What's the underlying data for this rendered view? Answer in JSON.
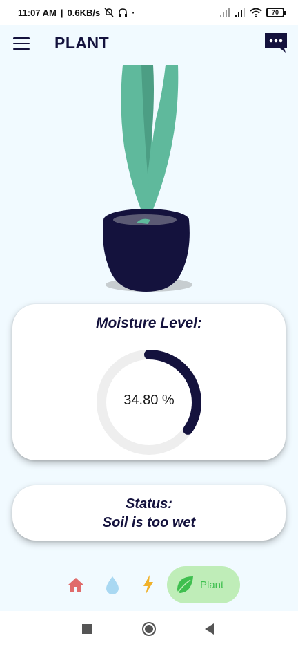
{
  "status_bar": {
    "time": "11:07 AM",
    "network_speed": "0.6KB/s",
    "battery": "70",
    "icons": [
      "mute-icon",
      "headphones-icon",
      "signal-icon",
      "signal-icon",
      "wifi-icon",
      "battery-icon"
    ]
  },
  "app_bar": {
    "title": "PLANT",
    "menu_icon": "hamburger-menu-icon",
    "chat_icon": "chat-bubble-icon"
  },
  "moisture": {
    "title": "Moisture Level:",
    "value_text": "34.80 %",
    "value_percent": 34.8
  },
  "status": {
    "title": "Status:",
    "text": "Soil is too wet"
  },
  "bottom_nav": {
    "items": [
      {
        "icon": "home-icon",
        "label": ""
      },
      {
        "icon": "water-drop-icon",
        "label": ""
      },
      {
        "icon": "lightning-icon",
        "label": ""
      },
      {
        "icon": "leaf-icon",
        "label": "Plant",
        "active": true
      }
    ]
  },
  "system_nav": {
    "icons": [
      "recents-square-icon",
      "home-circle-icon",
      "back-triangle-icon"
    ]
  },
  "colors": {
    "background": "#f1faff",
    "navy": "#14123d",
    "leaf_green": "#5fb99c",
    "active_tab_bg": "#bfedb8",
    "active_tab_text": "#3fbf4f",
    "gauge_track": "#eeeeee",
    "home_red": "#e06b6b",
    "water_blue": "#a9d8f2",
    "energy_yellow": "#f0b12a"
  }
}
